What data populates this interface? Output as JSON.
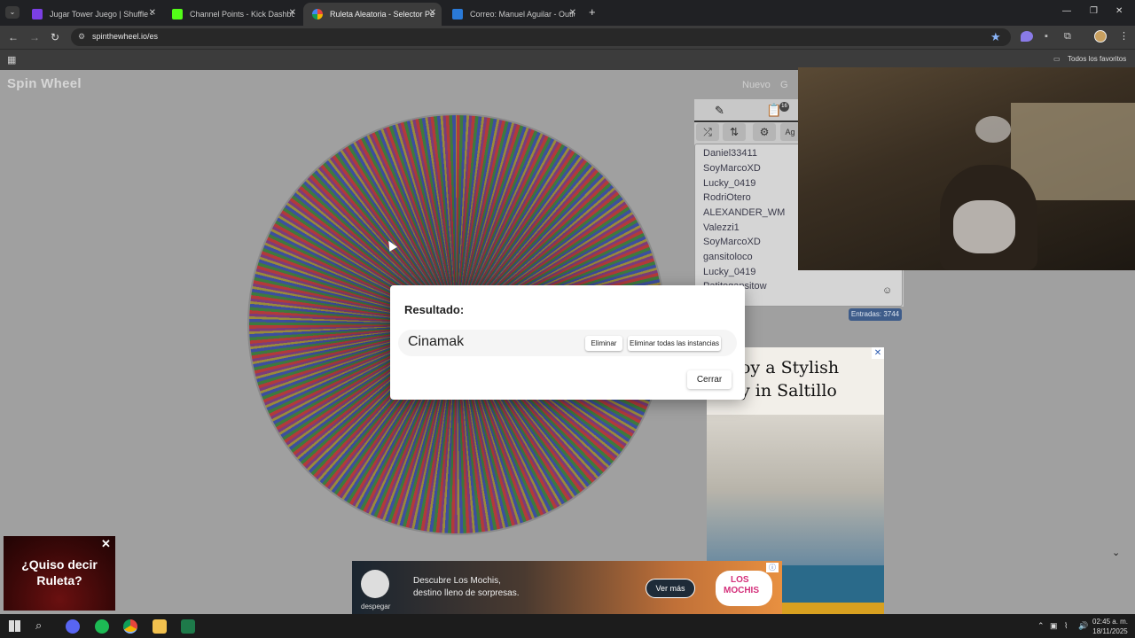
{
  "browser": {
    "tabs": [
      {
        "title": "Jugar Tower Juego | Shuffle - C",
        "favicon_color": "#7b3fe4"
      },
      {
        "title": "Channel Points - Kick Dashboard",
        "favicon_color": "#53fc18"
      },
      {
        "title": "Ruleta Aleatoria - Selector Pers",
        "favicon_color": "#e8453c"
      },
      {
        "title": "Correo: Manuel Aguilar - Outlo",
        "favicon_color": "#2a7ad8"
      }
    ],
    "new_tab": "+",
    "url": "spinthewheel.io/es",
    "bookmarks_folder": "Todos los favoritos",
    "window_controls": {
      "min": "—",
      "max": "❐",
      "close": "✕"
    }
  },
  "site": {
    "logo": "Spin Wheel",
    "nav": {
      "new_label": "Nuevo",
      "share_label": "G"
    },
    "panel_add_label": "Ag",
    "badge_count": "16",
    "entries": [
      "Daniel33411",
      "SoyMarcoXD",
      "Lucky_0419",
      "RodriOtero",
      "ALEXANDER_WM",
      "Valezzi1",
      "SoyMarcoXD",
      "gansitoloco",
      "Lucky_0419",
      "Patitogansitow"
    ],
    "entry_count": "Entradas: 3744",
    "emoji_icon": "☺"
  },
  "dialog": {
    "title": "Resultado:",
    "winner": "Cinamak",
    "remove_label": "Eliminar",
    "remove_all_label": "Eliminar todas las instancias",
    "close_label": "Cerrar"
  },
  "ad_right": {
    "headline_1": "Enjoy a Stylish",
    "headline_2": "Stay in Saltillo"
  },
  "ad_bottom": {
    "brand": "despegar",
    "text_1": "Descubre Los Mochis,",
    "text_2": "destino lleno de sorpresas.",
    "cta": "Ver más",
    "logo_1": "LOS",
    "logo_2": "MOCHIS"
  },
  "ad_corner": {
    "line_1": "¿Quiso decir",
    "line_2": "Ruleta?"
  },
  "taskbar": {
    "time": "02:45 a. m.",
    "date": "18/11/2025"
  }
}
